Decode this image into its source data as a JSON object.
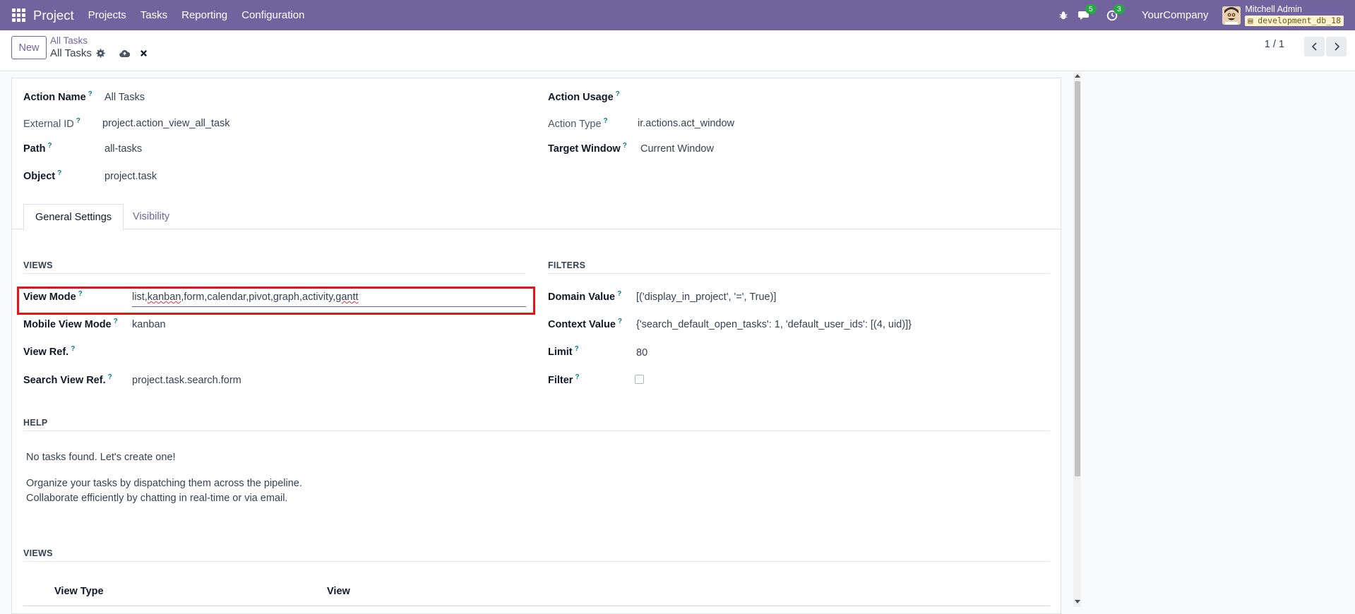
{
  "navbar": {
    "brand": "Project",
    "menu": [
      "Projects",
      "Tasks",
      "Reporting",
      "Configuration"
    ],
    "messages_count": "5",
    "activities_count": "3",
    "company": "YourCompany",
    "user_name": "Mitchell Admin",
    "database": "development_db_18"
  },
  "control_panel": {
    "new_label": "New",
    "breadcrumb_parent": "All Tasks",
    "record_title": "All Tasks",
    "pager": "1 / 1"
  },
  "form": {
    "action_name_label": "Action Name",
    "action_name_value": "All Tasks",
    "external_id_label": "External ID",
    "external_id_value": "project.action_view_all_task",
    "path_label": "Path",
    "path_value": "all-tasks",
    "object_label": "Object",
    "object_value": "project.task",
    "action_usage_label": "Action Usage",
    "action_type_label": "Action Type",
    "action_type_value": "ir.actions.act_window",
    "target_window_label": "Target Window",
    "target_window_value": "Current Window",
    "help_mark": "?"
  },
  "tabs": {
    "general": "General Settings",
    "visibility": "Visibility"
  },
  "views_section": {
    "title": "VIEWS",
    "view_mode_label": "View Mode",
    "view_mode_value": {
      "part1": "list,",
      "part2": "kanban",
      "part3": ",form,calendar,pivot,graph,activity,",
      "part4": "gantt"
    },
    "mobile_view_mode_label": "Mobile View Mode",
    "mobile_view_mode_value": "kanban",
    "view_ref_label": "View Ref.",
    "search_view_ref_label": "Search View Ref.",
    "search_view_ref_value": "project.task.search.form"
  },
  "filters_section": {
    "title": "FILTERS",
    "domain_label": "Domain Value",
    "domain_value": "[('display_in_project', '=', True)]",
    "context_label": "Context Value",
    "context_value": "{'search_default_open_tasks': 1, 'default_user_ids': [(4, uid)]}",
    "limit_label": "Limit",
    "limit_value": "80",
    "filter_label": "Filter",
    "filter_checked": false
  },
  "help_section": {
    "title": "HELP",
    "line1": "No tasks found. Let's create one!",
    "line2": "Organize your tasks by dispatching them across the pipeline.",
    "line3": "Collaborate efficiently by chatting in real-time or via email."
  },
  "views_table": {
    "title": "VIEWS",
    "columns": [
      "View Type",
      "View"
    ]
  },
  "colors": {
    "navbar": "#71639e",
    "highlight": "#e2151b",
    "badge": "#28a745"
  }
}
